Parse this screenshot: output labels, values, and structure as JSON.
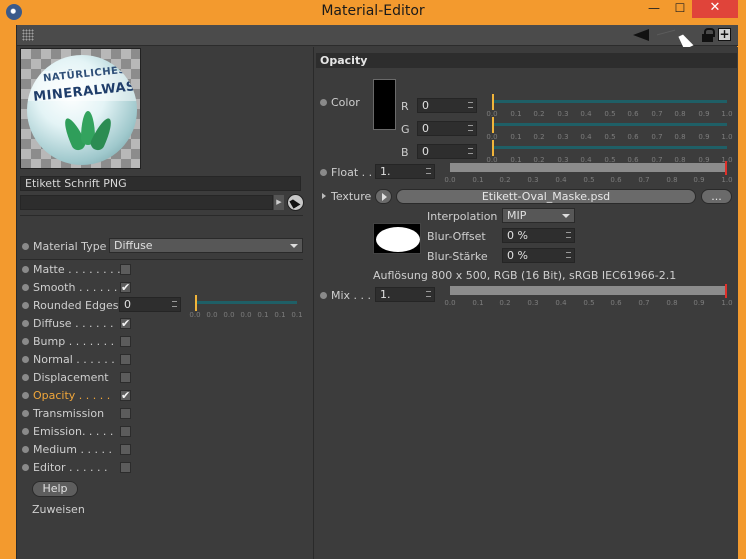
{
  "window": {
    "title": "Material-Editor",
    "min": "—",
    "max": "☐",
    "close": "✕"
  },
  "toolbar": {
    "new_window": "+"
  },
  "preview": {
    "line1": "NATÜRLICHES",
    "line2": "MINERALWASSER"
  },
  "material": {
    "name": "Etikett Schrift PNG",
    "type_label": "Material Type",
    "type_value": "Diffuse"
  },
  "channels": [
    {
      "label": "Matte . . . . . . . .",
      "checked": false,
      "active": false
    },
    {
      "label": "Smooth  . . . . . .",
      "checked": true,
      "active": false
    },
    {
      "label": "Rounded Edges",
      "checked": null,
      "active": false,
      "value": "0"
    },
    {
      "label": "Diffuse . . . . . .",
      "checked": true,
      "active": false
    },
    {
      "label": "Bump . . . . . . .",
      "checked": false,
      "active": false
    },
    {
      "label": "Normal . . . . . .",
      "checked": false,
      "active": false
    },
    {
      "label": "Displacement",
      "checked": false,
      "active": false
    },
    {
      "label": "Opacity . . . . .",
      "checked": true,
      "active": true
    },
    {
      "label": "Transmission",
      "checked": false,
      "active": false
    },
    {
      "label": "Emission. . . . .",
      "checked": false,
      "active": false
    },
    {
      "label": "Medium . . . . .",
      "checked": false,
      "active": false
    },
    {
      "label": "Editor . . . . . .",
      "checked": false,
      "active": false
    }
  ],
  "rounded_ticks": [
    "0.0",
    "0.0",
    "0.0",
    "0.0",
    "0.1",
    "0.1",
    "0.1"
  ],
  "help_label": "Help",
  "assign_label": "Zuweisen",
  "checkmark": "✔",
  "opacity": {
    "header": "Opacity",
    "color_label": "Color",
    "channels": [
      {
        "name": "R",
        "value": "0",
        "level": 0
      },
      {
        "name": "G",
        "value": "0",
        "level": 0
      },
      {
        "name": "B",
        "value": "0",
        "level": 0
      }
    ],
    "float_label": "Float . .",
    "float_value": "1.",
    "float_level": 1.0,
    "texture_label": "Texture",
    "texture_file": "Etikett-Oval_Maske.psd",
    "more_label": "...",
    "interpolation_label": "Interpolation",
    "interpolation_value": "MIP",
    "blur_offset_label": "Blur-Offset",
    "blur_offset_value": "0 %",
    "blur_strength_label": "Blur-Stärke",
    "blur_strength_value": "0 %",
    "info": "Auflösung 800 x 500, RGB (16 Bit), sRGB IEC61966-2.1",
    "mix_label": "Mix . . . .",
    "mix_value": "1.",
    "mix_level": 1.0,
    "ticks": [
      "0.0",
      "0.1",
      "0.2",
      "0.3",
      "0.4",
      "0.5",
      "0.6",
      "0.7",
      "0.8",
      "0.9",
      "1.0"
    ]
  },
  "colors": {
    "accent": "#f0a63a",
    "window_frame": "#f39a2e",
    "panel": "#3c3c3c",
    "close": "#e0443a"
  }
}
